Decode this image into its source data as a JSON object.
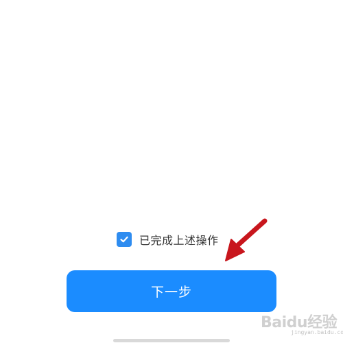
{
  "confirm": {
    "checked": true,
    "label": "已完成上述操作"
  },
  "next_button": {
    "label": "下一步"
  },
  "annotation": {
    "color": "#c8161d"
  },
  "watermark": {
    "brand": "Baidu经验",
    "sub": "jingyan.baidu.com"
  },
  "colors": {
    "accent": "#1b8cff",
    "checkbox": "#2e8cf0"
  }
}
